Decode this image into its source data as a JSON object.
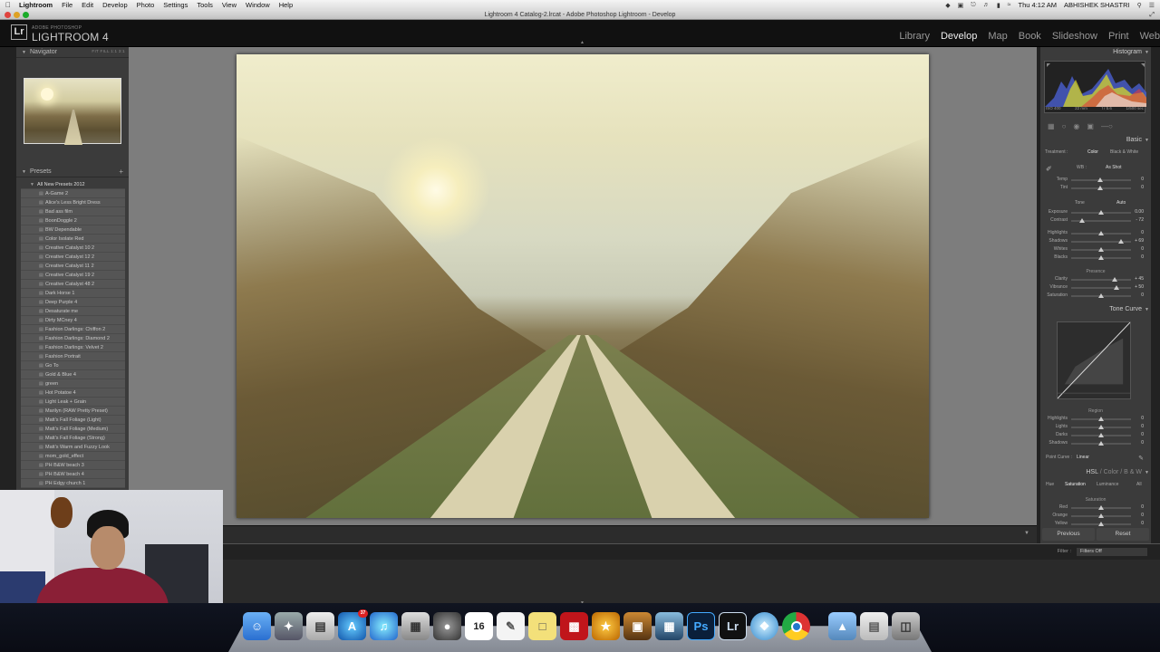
{
  "menubar": {
    "apple": "",
    "app": "Lightroom",
    "items": [
      "File",
      "Edit",
      "Develop",
      "Photo",
      "Settings",
      "Tools",
      "View",
      "Window",
      "Help"
    ],
    "clock": "Thu 4:12 AM",
    "user": "ABHISHEK SHASTRI"
  },
  "window": {
    "title": "Lightroom 4 Catalog-2.lrcat - Adobe Photoshop Lightroom - Develop"
  },
  "identity": {
    "badge": "Lr",
    "sub": "ADOBE PHOTOSHOP",
    "title": "LIGHTROOM 4",
    "modules": [
      "Library",
      "Develop",
      "Map",
      "Book",
      "Slideshow",
      "Print",
      "Web"
    ],
    "active_module": "Develop"
  },
  "navigator": {
    "label": "Navigator",
    "options": "FIT  FILL  1:1  3:1"
  },
  "presets": {
    "label": "Presets",
    "add": "+",
    "folder": "All New Presets 2012",
    "items": [
      "A-Game 2",
      "Alice's Less Bright Dress",
      "Bad ass film",
      "BoonDoggle 2",
      "BW Dependable",
      "Color Isolate Red",
      "Creative Catalyst 10 2",
      "Creative Catalyst 12 2",
      "Creative Catalyst 11 2",
      "Creative Catalyst 19 2",
      "Creative Catalyst 48 2",
      "Dark Horse 1",
      "Deep Purple 4",
      "Desaturate me",
      "Dirty MCney 4",
      "Fashion Darlings: Chiffon 2",
      "Fashion Darlings: Diamond 2",
      "Fashion Darlings: Velvet 2",
      "Fashion Portrait",
      "Go To",
      "Gold & Blue 4",
      "green",
      "Hot Potatoe 4",
      "Light Leak + Grain",
      "Marilyn (RAW Pretty Preset)",
      "Matt's Fall Foliage (Light)",
      "Matt's Fall Foliage (Medium)",
      "Matt's Fall Foliage (Strong)",
      "Matt's Warm and Fuzzy Look",
      "mom_gold_effect",
      "PH B&W beach 3",
      "PH B&W beach 4",
      "PH Edgy church 1"
    ]
  },
  "histogram": {
    "label": "Histogram",
    "info": [
      "ISO 400",
      "22 mm",
      "f / 5.6",
      "1/500 sec"
    ]
  },
  "basic": {
    "label": "Basic",
    "treatment_label": "Treatment :",
    "treatment_color": "Color",
    "treatment_bw": "Black & White",
    "wb_label": "WB :",
    "wb_value": "As Shot",
    "tone_label": "Tone",
    "auto": "Auto",
    "presence_label": "Presence",
    "sliders_wb": [
      {
        "name": "Temp",
        "pos": 0.48,
        "value": "0"
      },
      {
        "name": "Tint",
        "pos": 0.48,
        "value": "0"
      }
    ],
    "sliders_tone": [
      {
        "name": "Exposure",
        "pos": 0.5,
        "value": "0.00"
      },
      {
        "name": "Contrast",
        "pos": 0.18,
        "value": "- 72"
      }
    ],
    "sliders_tone2": [
      {
        "name": "Highlights",
        "pos": 0.5,
        "value": "0"
      },
      {
        "name": "Shadows",
        "pos": 0.84,
        "value": "+ 69"
      },
      {
        "name": "Whites",
        "pos": 0.5,
        "value": "0"
      },
      {
        "name": "Blacks",
        "pos": 0.5,
        "value": "0"
      }
    ],
    "sliders_presence": [
      {
        "name": "Clarity",
        "pos": 0.72,
        "value": "+ 45"
      },
      {
        "name": "Vibrance",
        "pos": 0.75,
        "value": "+ 50"
      },
      {
        "name": "Saturation",
        "pos": 0.5,
        "value": "0"
      }
    ]
  },
  "tonecurve": {
    "label": "Tone Curve",
    "region": "Region",
    "sliders": [
      {
        "name": "Highlights",
        "pos": 0.5,
        "value": "0"
      },
      {
        "name": "Lights",
        "pos": 0.5,
        "value": "0"
      },
      {
        "name": "Darks",
        "pos": 0.5,
        "value": "0"
      },
      {
        "name": "Shadows",
        "pos": 0.5,
        "value": "0"
      }
    ],
    "point_curve_label": "Point Curve :",
    "point_curve_value": "Linear"
  },
  "hsl": {
    "label_hsl": "HSL",
    "label_color": "Color",
    "label_bw": "B & W",
    "tabs": [
      "Hue",
      "Saturation",
      "Luminance",
      "All"
    ],
    "active_tab": "Saturation",
    "sub": "Saturation",
    "sliders": [
      {
        "name": "Red",
        "pos": 0.5,
        "value": "0"
      },
      {
        "name": "Orange",
        "pos": 0.5,
        "value": "0"
      },
      {
        "name": "Yellow",
        "pos": 0.5,
        "value": "0"
      }
    ]
  },
  "buttons": {
    "previous": "Previous",
    "reset": "Reset"
  },
  "filmstrip": {
    "filter_label": "Filter :",
    "filter_value": "Filters Off"
  },
  "dock": {
    "calendar_day": "16",
    "appstore_badge": "37",
    "ps": "Ps",
    "lr": "Lr"
  },
  "colors": {
    "accent": "#e8e8e8",
    "panel": "#3b3b3b",
    "center_bg": "#7d7d7d"
  }
}
